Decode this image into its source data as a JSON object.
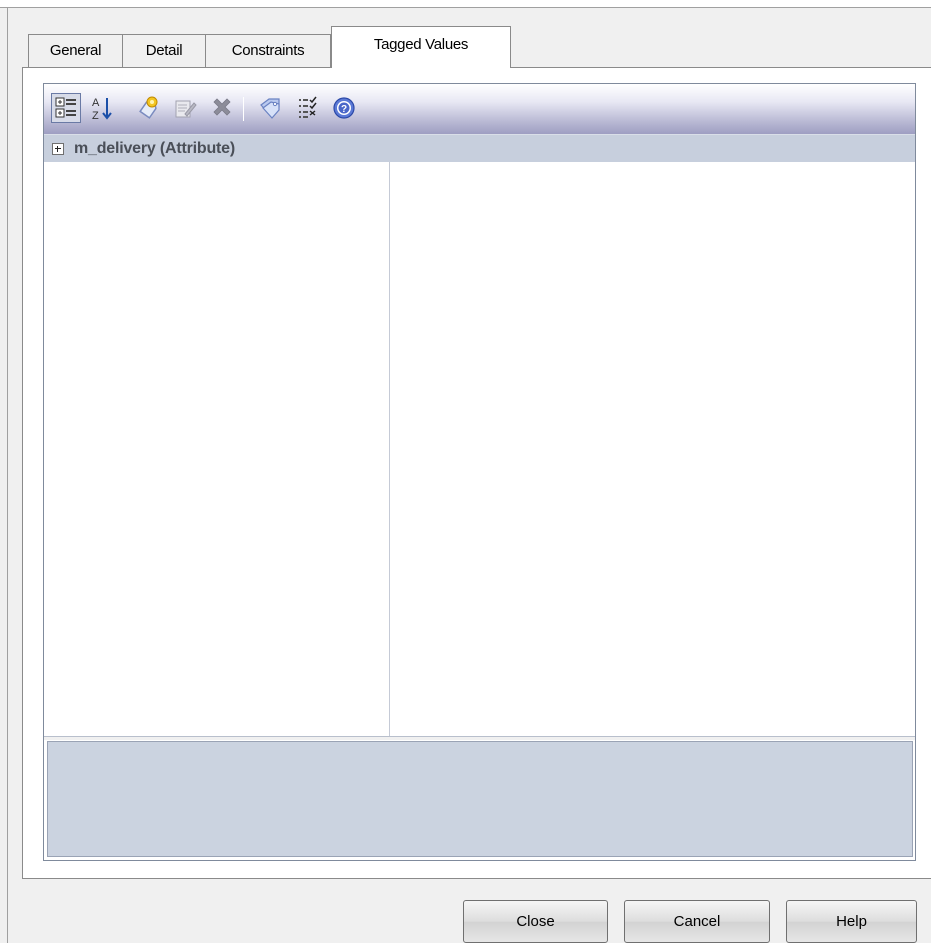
{
  "tabs": [
    {
      "label": "General",
      "active": false
    },
    {
      "label": "Detail",
      "active": false
    },
    {
      "label": "Constraints",
      "active": false
    },
    {
      "label": "Tagged Values",
      "active": true
    }
  ],
  "toolbar": {
    "buttons": [
      {
        "icon": "categorized-view-icon",
        "pressed": true
      },
      {
        "icon": "sort-alphabetical-icon",
        "pressed": false
      },
      {
        "icon": "new-tag-icon",
        "pressed": false
      },
      {
        "icon": "edit-tag-icon",
        "pressed": false
      },
      {
        "icon": "delete-icon",
        "pressed": false
      },
      {
        "icon": "tag-view-icon",
        "pressed": false
      },
      {
        "icon": "checklist-icon",
        "pressed": false
      },
      {
        "icon": "help-icon",
        "pressed": false
      }
    ]
  },
  "property_grid": {
    "category_label": "m_delivery (Attribute)",
    "expanded": false
  },
  "buttons": {
    "close": "Close",
    "cancel": "Cancel",
    "help": "Help"
  }
}
